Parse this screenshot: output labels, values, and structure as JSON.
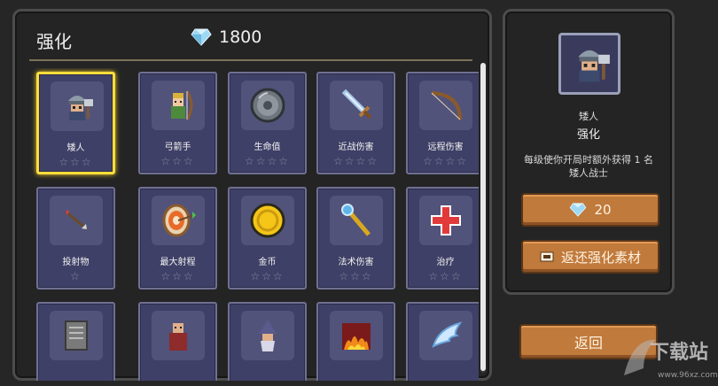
{
  "header": {
    "title": "强化",
    "gems": "1800",
    "gem_icon": "diamond-icon"
  },
  "cards": [
    {
      "label": "矮人",
      "icon": "dwarf-icon",
      "stars": "☆☆☆",
      "selected": true
    },
    {
      "label": "弓箭手",
      "icon": "archer-icon",
      "stars": "☆☆☆"
    },
    {
      "label": "生命值",
      "icon": "shield-icon",
      "stars": "☆☆☆☆"
    },
    {
      "label": "近战伤害",
      "icon": "sword-icon",
      "stars": "☆☆☆☆"
    },
    {
      "label": "远程伤害",
      "icon": "bow-icon",
      "stars": "☆☆☆☆"
    },
    {
      "label": "投射物",
      "icon": "arrow-icon",
      "stars": "☆"
    },
    {
      "label": "最大射程",
      "icon": "target-icon",
      "stars": "☆☆☆"
    },
    {
      "label": "金币",
      "icon": "coin-icon",
      "stars": "☆☆☆"
    },
    {
      "label": "法术伤害",
      "icon": "staff-icon",
      "stars": "☆☆☆"
    },
    {
      "label": "治疗",
      "icon": "heal-cross-icon",
      "stars": "☆☆☆"
    },
    {
      "label": "",
      "icon": "book-icon",
      "stars": ""
    },
    {
      "label": "",
      "icon": "monk-icon",
      "stars": ""
    },
    {
      "label": "",
      "icon": "wizard-icon",
      "stars": ""
    },
    {
      "label": "",
      "icon": "fire-icon",
      "stars": ""
    },
    {
      "label": "",
      "icon": "wing-icon",
      "stars": ""
    }
  ],
  "detail": {
    "name": "矮人",
    "subtitle": "强化",
    "description": "每级使你开局时额外获得 1 名矮人战士",
    "cost": "20",
    "refund_label": "返还强化素材"
  },
  "back_label": "返回",
  "watermark": {
    "text": "下载站",
    "url": "www.96xz.com"
  },
  "colors": {
    "card_bg": "#3f4067",
    "selected_border": "#ffdd3c",
    "button": "#c07a3c",
    "diamond": "#9fd8f5"
  }
}
